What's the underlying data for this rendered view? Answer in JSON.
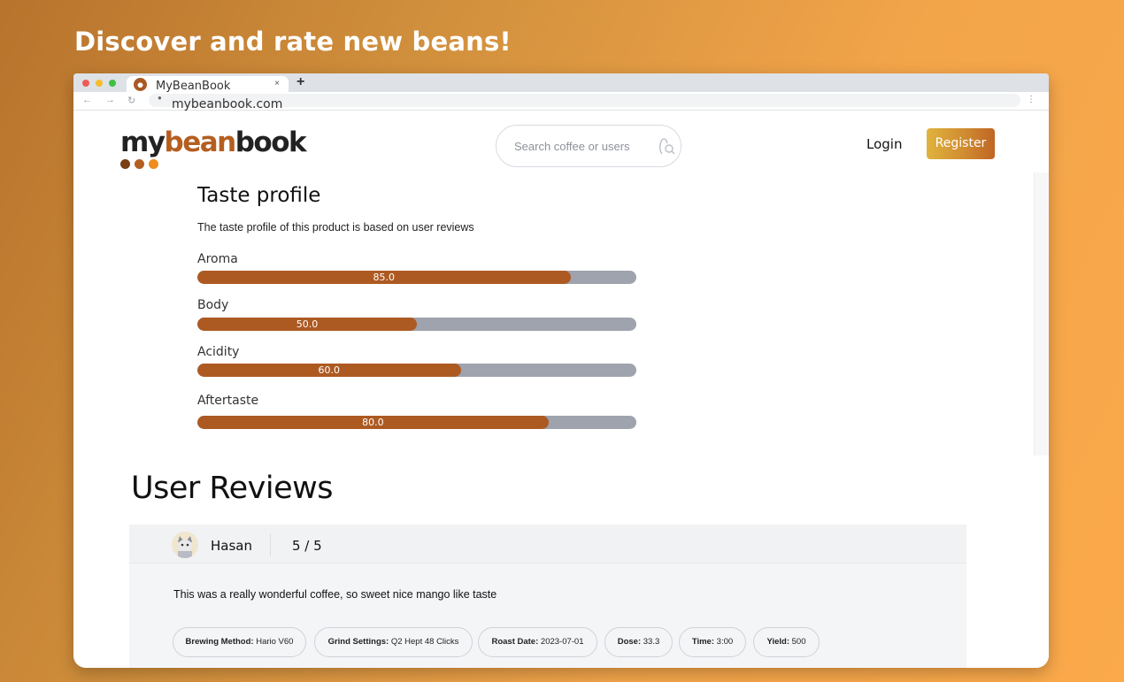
{
  "headline": "Discover and rate new beans!",
  "browser": {
    "tab_title": "MyBeanBook",
    "tab_close": "×",
    "new_tab": "+",
    "url": "mybeanbook.com"
  },
  "header": {
    "logo": {
      "my": "my",
      "bean": "bean",
      "book": "book"
    },
    "logo_dot_colors": [
      "#7a3f12",
      "#b45e20",
      "#f08b1d"
    ],
    "search_placeholder": "Search coffee or users",
    "login_label": "Login",
    "register_label": "Register"
  },
  "taste_profile": {
    "title": "Taste profile",
    "subtitle": "The taste profile of this product is based on user reviews",
    "attributes": [
      {
        "label": "Aroma",
        "value": 85.0,
        "value_label": "85.0"
      },
      {
        "label": "Body",
        "value": 50.0,
        "value_label": "50.0"
      },
      {
        "label": "Acidity",
        "value": 60.0,
        "value_label": "60.0"
      },
      {
        "label": "Aftertaste",
        "value": 80.0,
        "value_label": "80.0"
      }
    ]
  },
  "reviews": {
    "title": "User Reviews",
    "items": [
      {
        "user": "Hasan",
        "rating": "5 / 5",
        "text": "This was a really wonderful coffee, so sweet nice mango like taste",
        "chips": [
          {
            "label": "Brewing Method:",
            "value": "Hario V60"
          },
          {
            "label": "Grind Settings:",
            "value": "Q2 Hept 48 Clicks"
          },
          {
            "label": "Roast Date:",
            "value": "2023-07-01"
          },
          {
            "label": "Dose:",
            "value": "33.3"
          },
          {
            "label": "Time:",
            "value": "3:00"
          },
          {
            "label": "Yield:",
            "value": "500"
          }
        ]
      }
    ]
  },
  "colors": {
    "accent": "#ad5a22",
    "bar_track": "#9ea3ad",
    "register_gradient": [
      "#e0b33e",
      "#c06524"
    ]
  }
}
